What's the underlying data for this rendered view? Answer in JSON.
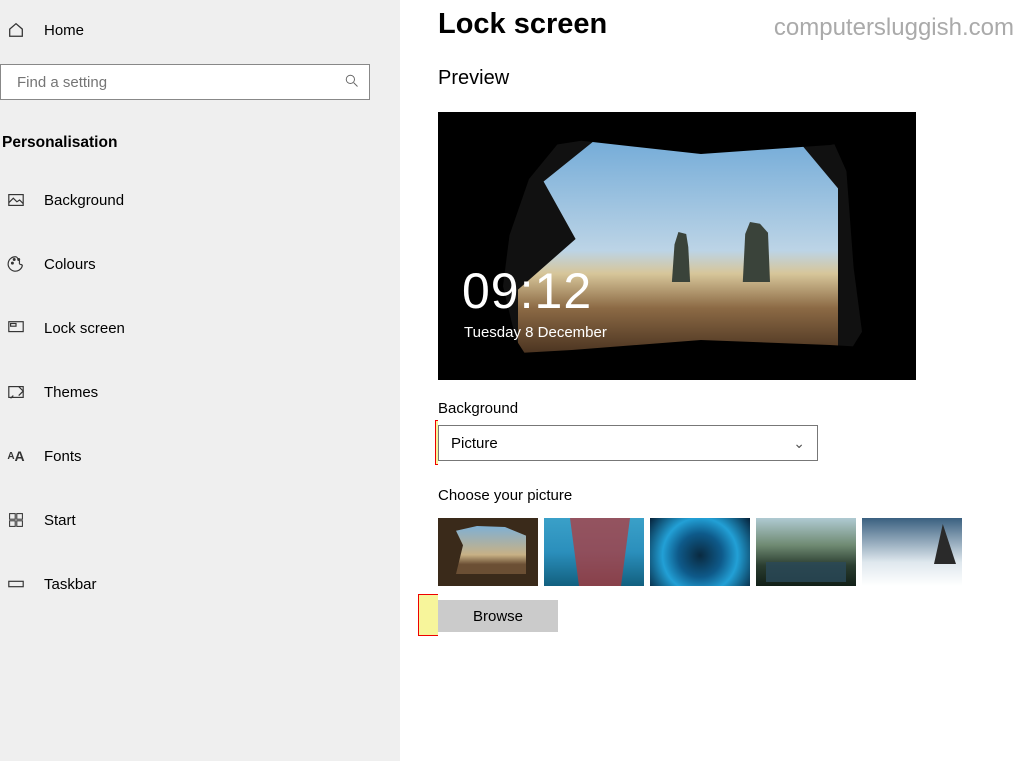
{
  "sidebar": {
    "home_label": "Home",
    "search_placeholder": "Find a setting",
    "category_label": "Personalisation",
    "items": [
      {
        "icon": "image-icon",
        "label": "Background"
      },
      {
        "icon": "palette-icon",
        "label": "Colours"
      },
      {
        "icon": "monitor-icon",
        "label": "Lock screen",
        "selected": true
      },
      {
        "icon": "themes-icon",
        "label": "Themes"
      },
      {
        "icon": "font-icon",
        "label": "Fonts"
      },
      {
        "icon": "start-icon",
        "label": "Start"
      },
      {
        "icon": "taskbar-icon",
        "label": "Taskbar"
      }
    ]
  },
  "main": {
    "title": "Lock screen",
    "watermark": "computersluggish.com",
    "preview_label": "Preview",
    "preview_time": "09:12",
    "preview_date": "Tuesday 8 December",
    "background_label": "Background",
    "background_dropdown_value": "Picture",
    "choose_picture_label": "Choose your picture",
    "browse_label": "Browse"
  }
}
